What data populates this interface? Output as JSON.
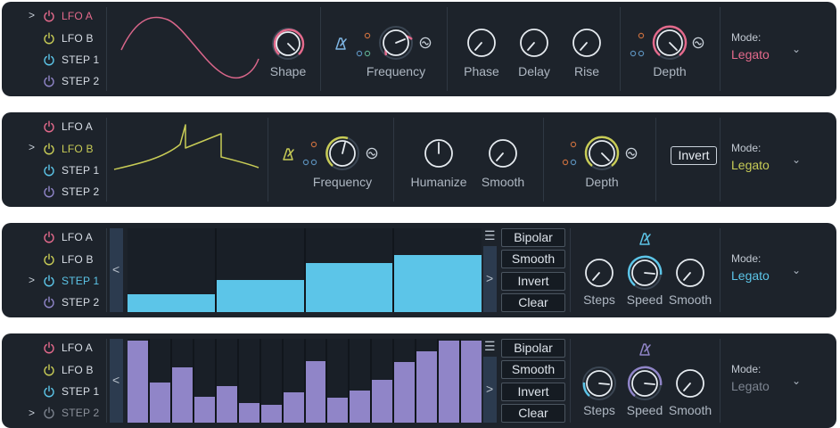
{
  "sidebar_items": [
    "LFO A",
    "LFO B",
    "STEP 1",
    "STEP 2"
  ],
  "colors": {
    "lfo_a": "#e46a8c",
    "lfo_b": "#c8cc56",
    "step1": "#5cc5e8",
    "step2": "#9085c8",
    "panel": "#1d232b"
  },
  "panels": [
    {
      "selected": "LFO A",
      "knobs": [
        "Shape",
        "Frequency",
        "Phase",
        "Delay",
        "Rise",
        "Depth"
      ],
      "mode_label": "Mode:",
      "mode_value": "Legato"
    },
    {
      "selected": "LFO B",
      "knobs": [
        "Frequency",
        "Humanize",
        "Smooth",
        "Depth"
      ],
      "invert_label": "Invert",
      "mode_label": "Mode:",
      "mode_value": "Legato"
    },
    {
      "selected": "STEP 1",
      "step_values": [
        0.21,
        0.38,
        0.58,
        0.68
      ],
      "buttons": [
        "Bipolar",
        "Smooth",
        "Invert",
        "Clear"
      ],
      "knobs": [
        "Steps",
        "Speed",
        "Smooth"
      ],
      "mode_label": "Mode:",
      "mode_value": "Legato"
    },
    {
      "selected": "STEP 2",
      "step_values": [
        0.98,
        0.48,
        0.66,
        0.31,
        0.44,
        0.23,
        0.21,
        0.36,
        0.73,
        0.3,
        0.38,
        0.51,
        0.72,
        0.85,
        0.98,
        0.98
      ],
      "buttons": [
        "Bipolar",
        "Smooth",
        "Invert",
        "Clear"
      ],
      "knobs": [
        "Steps",
        "Speed",
        "Smooth"
      ],
      "mode_label": "Mode:",
      "mode_value": "Legato"
    }
  ],
  "icons": [
    "chevron-right-icon",
    "power-icon",
    "metronome-icon",
    "sync-icon",
    "chevron-down-icon",
    "chevron-left-icon",
    "menu-icon"
  ]
}
